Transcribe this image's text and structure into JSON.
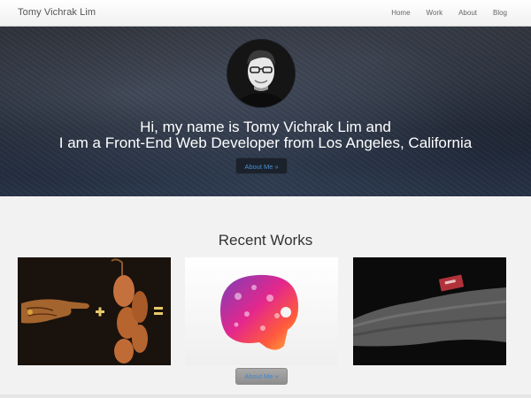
{
  "navbar": {
    "brand": "Tomy Vichrak Lim",
    "links": [
      {
        "label": "Home"
      },
      {
        "label": "Work"
      },
      {
        "label": "About"
      },
      {
        "label": "Blog"
      }
    ]
  },
  "hero": {
    "line1": "Hi, my name is Tomy Vichrak Lim and",
    "line2": "I am a Front-End Web Developer from Los Angeles, California",
    "button_label": "About Me »",
    "avatar_icon": "avatar-portrait"
  },
  "works": {
    "title": "Recent Works",
    "items": [
      {
        "icon": "hand-plus-sausage-equals-artwork"
      },
      {
        "icon": "colorful-brain-icons-artwork"
      },
      {
        "icon": "gray-sweater-red-tag-photo"
      }
    ],
    "button_label": "About Me »"
  },
  "colors": {
    "link_blue": "#4a8fd2",
    "hero_dark": "#1c2330",
    "section_bg": "#f2f2f2"
  }
}
